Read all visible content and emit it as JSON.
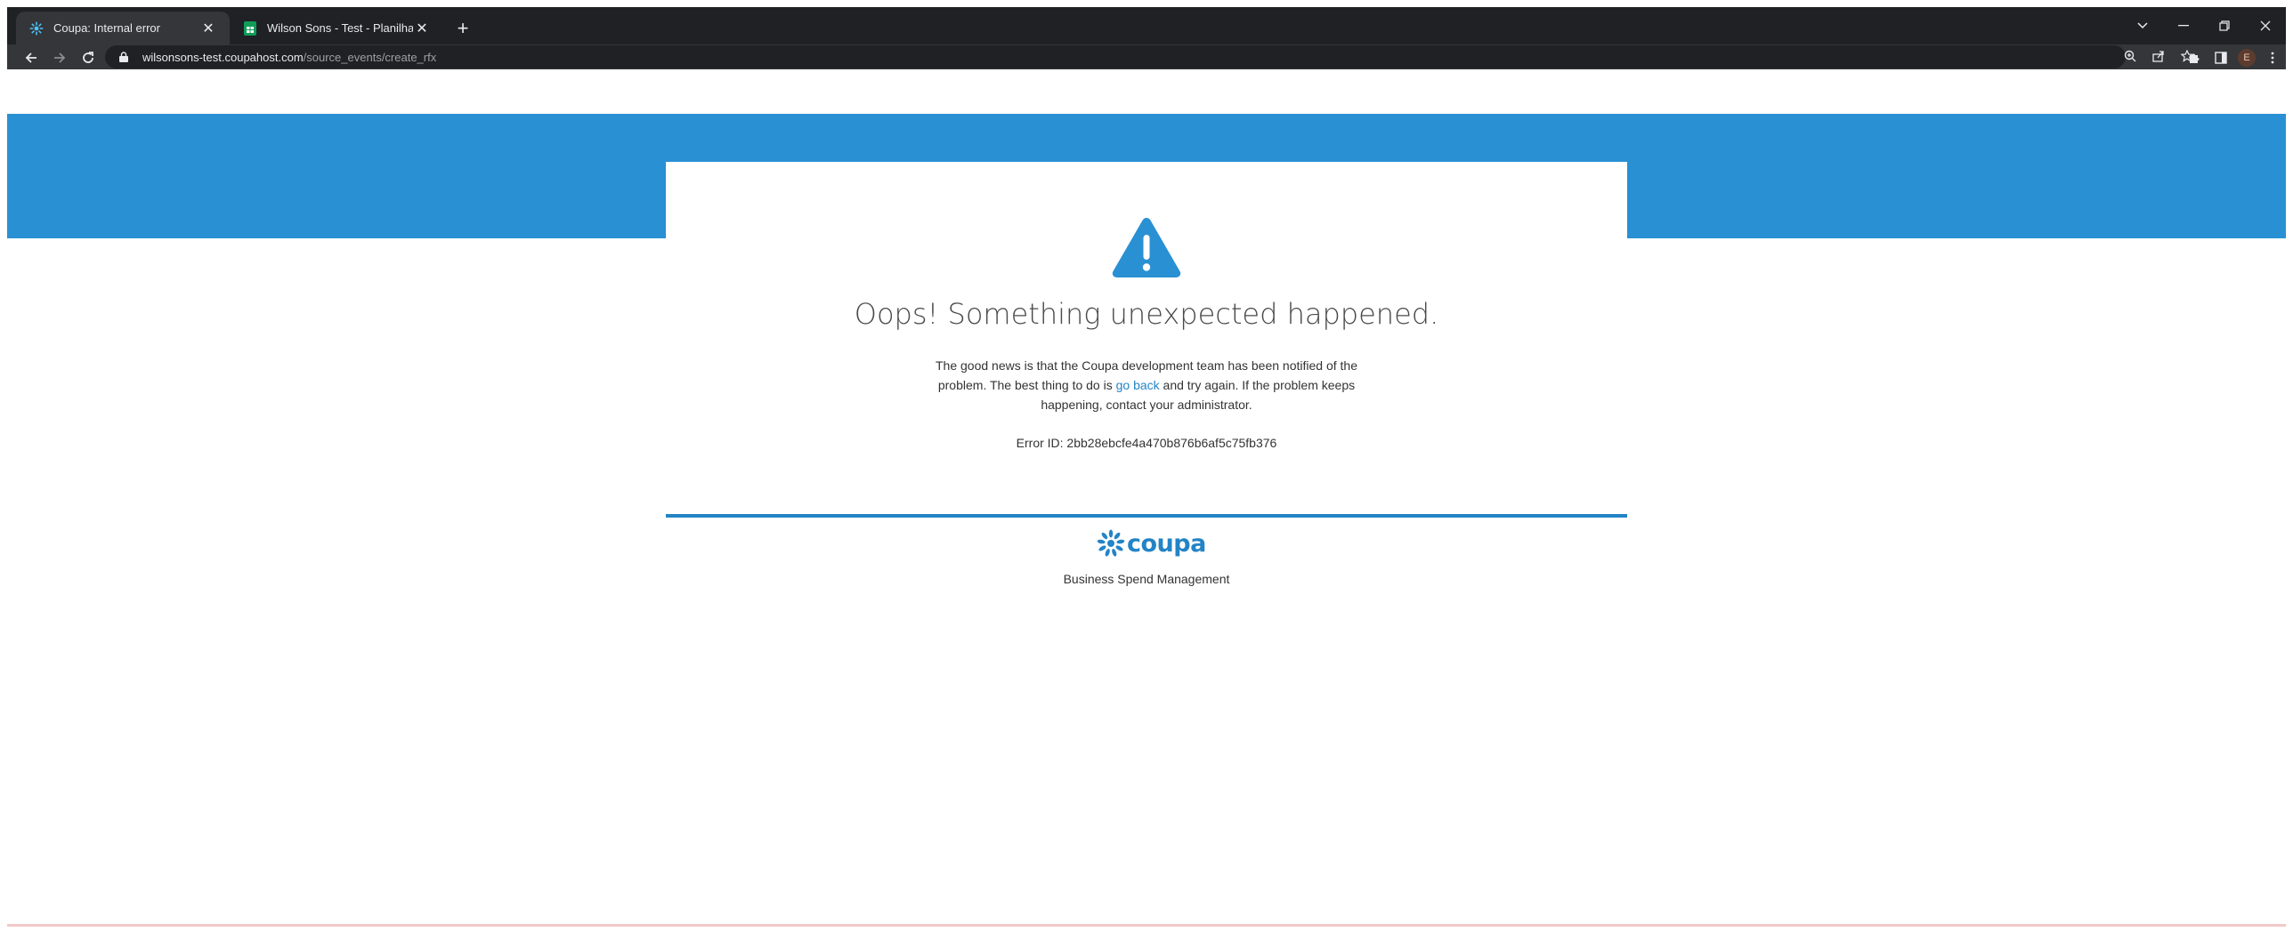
{
  "browser": {
    "tabs": [
      {
        "title": "Coupa: Internal error",
        "active": true
      },
      {
        "title": "Wilson Sons - Test - Planilhas Go",
        "active": false
      }
    ],
    "new_tab_symbol": "+",
    "url_host": "wilsonsons-test.coupahost.com",
    "url_path": "/source_events/create_rfx",
    "profile_initial": "E",
    "profile_color": "#5c3c2e"
  },
  "error_page": {
    "headline": "Oops! Something unexpected happened.",
    "message_before": "The good news is that the Coupa development team has been notified of the problem. The best thing to do is ",
    "link_text": "go back",
    "message_after": " and try again. If the problem keeps happening, contact your administrator.",
    "error_id": "Error ID: 2bb28ebcfe4a470b876b6af5c75fb376"
  },
  "footer": {
    "logo_text": "coupa",
    "tagline": "Business Spend Management"
  },
  "colors": {
    "brand_blue": "#2990d3",
    "accent_blue": "#2384c6",
    "chrome_dark": "#202124"
  }
}
